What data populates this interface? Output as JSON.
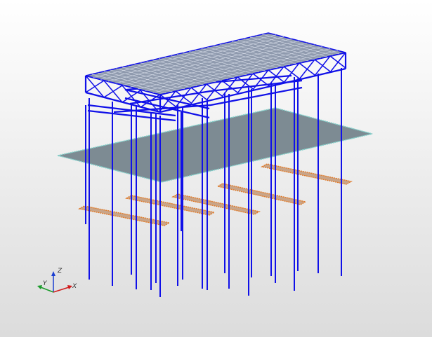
{
  "view": {
    "type": "3d-structural-model-viewport",
    "background_top": "#ffffff",
    "background_bottom": "#d9d9d9"
  },
  "colors": {
    "frame_members": "#1010e8",
    "roof_deck": "#8f9aae",
    "roof_deck_grid": "#d6dce8",
    "slab": "#7d8b93",
    "slab_edge": "#7ecfc9",
    "footing": "#c9a589",
    "footing_edge": "#e07b2a"
  },
  "triad": {
    "x_label": "X",
    "y_label": "Y",
    "z_label": "Z",
    "x_color": "#d11a1a",
    "y_color": "#1a9b2a",
    "z_color": "#1a3ed1"
  }
}
